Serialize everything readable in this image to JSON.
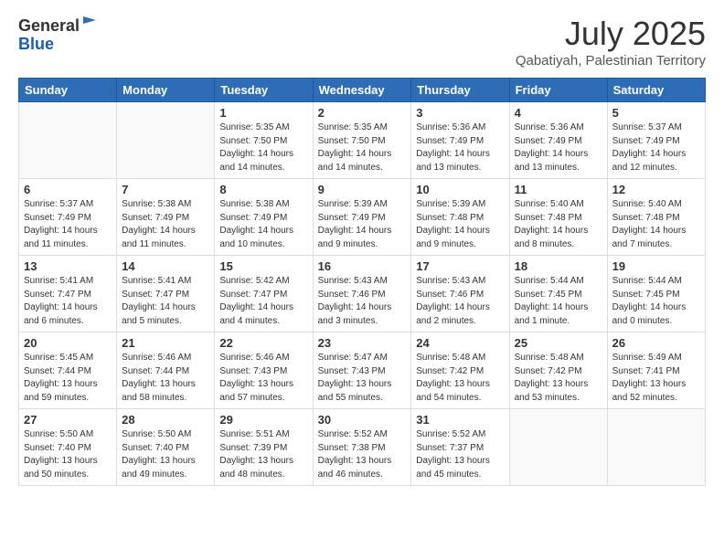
{
  "logo": {
    "general": "General",
    "blue": "Blue"
  },
  "header": {
    "title": "July 2025",
    "subtitle": "Qabatiyah, Palestinian Territory"
  },
  "weekdays": [
    "Sunday",
    "Monday",
    "Tuesday",
    "Wednesday",
    "Thursday",
    "Friday",
    "Saturday"
  ],
  "weeks": [
    [
      {
        "day": "",
        "info": ""
      },
      {
        "day": "",
        "info": ""
      },
      {
        "day": "1",
        "info": "Sunrise: 5:35 AM\nSunset: 7:50 PM\nDaylight: 14 hours and 14 minutes."
      },
      {
        "day": "2",
        "info": "Sunrise: 5:35 AM\nSunset: 7:50 PM\nDaylight: 14 hours and 14 minutes."
      },
      {
        "day": "3",
        "info": "Sunrise: 5:36 AM\nSunset: 7:49 PM\nDaylight: 14 hours and 13 minutes."
      },
      {
        "day": "4",
        "info": "Sunrise: 5:36 AM\nSunset: 7:49 PM\nDaylight: 14 hours and 13 minutes."
      },
      {
        "day": "5",
        "info": "Sunrise: 5:37 AM\nSunset: 7:49 PM\nDaylight: 14 hours and 12 minutes."
      }
    ],
    [
      {
        "day": "6",
        "info": "Sunrise: 5:37 AM\nSunset: 7:49 PM\nDaylight: 14 hours and 11 minutes."
      },
      {
        "day": "7",
        "info": "Sunrise: 5:38 AM\nSunset: 7:49 PM\nDaylight: 14 hours and 11 minutes."
      },
      {
        "day": "8",
        "info": "Sunrise: 5:38 AM\nSunset: 7:49 PM\nDaylight: 14 hours and 10 minutes."
      },
      {
        "day": "9",
        "info": "Sunrise: 5:39 AM\nSunset: 7:49 PM\nDaylight: 14 hours and 9 minutes."
      },
      {
        "day": "10",
        "info": "Sunrise: 5:39 AM\nSunset: 7:48 PM\nDaylight: 14 hours and 9 minutes."
      },
      {
        "day": "11",
        "info": "Sunrise: 5:40 AM\nSunset: 7:48 PM\nDaylight: 14 hours and 8 minutes."
      },
      {
        "day": "12",
        "info": "Sunrise: 5:40 AM\nSunset: 7:48 PM\nDaylight: 14 hours and 7 minutes."
      }
    ],
    [
      {
        "day": "13",
        "info": "Sunrise: 5:41 AM\nSunset: 7:47 PM\nDaylight: 14 hours and 6 minutes."
      },
      {
        "day": "14",
        "info": "Sunrise: 5:41 AM\nSunset: 7:47 PM\nDaylight: 14 hours and 5 minutes."
      },
      {
        "day": "15",
        "info": "Sunrise: 5:42 AM\nSunset: 7:47 PM\nDaylight: 14 hours and 4 minutes."
      },
      {
        "day": "16",
        "info": "Sunrise: 5:43 AM\nSunset: 7:46 PM\nDaylight: 14 hours and 3 minutes."
      },
      {
        "day": "17",
        "info": "Sunrise: 5:43 AM\nSunset: 7:46 PM\nDaylight: 14 hours and 2 minutes."
      },
      {
        "day": "18",
        "info": "Sunrise: 5:44 AM\nSunset: 7:45 PM\nDaylight: 14 hours and 1 minute."
      },
      {
        "day": "19",
        "info": "Sunrise: 5:44 AM\nSunset: 7:45 PM\nDaylight: 14 hours and 0 minutes."
      }
    ],
    [
      {
        "day": "20",
        "info": "Sunrise: 5:45 AM\nSunset: 7:44 PM\nDaylight: 13 hours and 59 minutes."
      },
      {
        "day": "21",
        "info": "Sunrise: 5:46 AM\nSunset: 7:44 PM\nDaylight: 13 hours and 58 minutes."
      },
      {
        "day": "22",
        "info": "Sunrise: 5:46 AM\nSunset: 7:43 PM\nDaylight: 13 hours and 57 minutes."
      },
      {
        "day": "23",
        "info": "Sunrise: 5:47 AM\nSunset: 7:43 PM\nDaylight: 13 hours and 55 minutes."
      },
      {
        "day": "24",
        "info": "Sunrise: 5:48 AM\nSunset: 7:42 PM\nDaylight: 13 hours and 54 minutes."
      },
      {
        "day": "25",
        "info": "Sunrise: 5:48 AM\nSunset: 7:42 PM\nDaylight: 13 hours and 53 minutes."
      },
      {
        "day": "26",
        "info": "Sunrise: 5:49 AM\nSunset: 7:41 PM\nDaylight: 13 hours and 52 minutes."
      }
    ],
    [
      {
        "day": "27",
        "info": "Sunrise: 5:50 AM\nSunset: 7:40 PM\nDaylight: 13 hours and 50 minutes."
      },
      {
        "day": "28",
        "info": "Sunrise: 5:50 AM\nSunset: 7:40 PM\nDaylight: 13 hours and 49 minutes."
      },
      {
        "day": "29",
        "info": "Sunrise: 5:51 AM\nSunset: 7:39 PM\nDaylight: 13 hours and 48 minutes."
      },
      {
        "day": "30",
        "info": "Sunrise: 5:52 AM\nSunset: 7:38 PM\nDaylight: 13 hours and 46 minutes."
      },
      {
        "day": "31",
        "info": "Sunrise: 5:52 AM\nSunset: 7:37 PM\nDaylight: 13 hours and 45 minutes."
      },
      {
        "day": "",
        "info": ""
      },
      {
        "day": "",
        "info": ""
      }
    ]
  ]
}
